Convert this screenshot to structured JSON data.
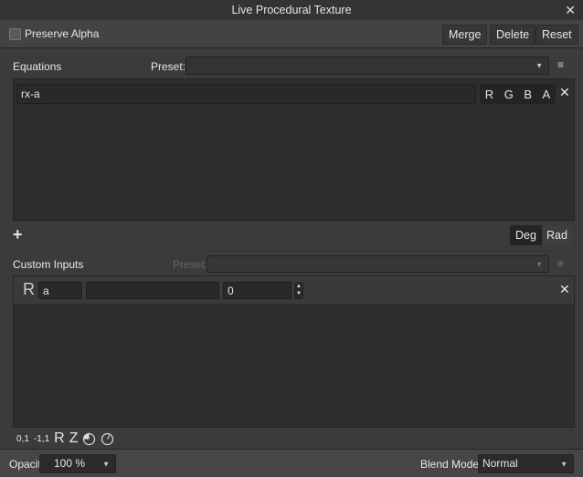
{
  "window": {
    "title": "Live Procedural Texture"
  },
  "toolbar": {
    "preserve_alpha": "Preserve Alpha",
    "preserve_alpha_checked": false,
    "merge": "Merge",
    "delete": "Delete",
    "reset": "Reset"
  },
  "equations": {
    "label": "Equations",
    "preset_label": "Preset:",
    "preset_value": "",
    "rows": [
      {
        "expression": "rx-a",
        "channels": [
          "R",
          "G",
          "B",
          "A"
        ]
      }
    ],
    "add": "+",
    "deg": "Deg",
    "rad": "Rad"
  },
  "custom_inputs": {
    "label": "Custom Inputs",
    "preset_label": "Preset:",
    "rows": [
      {
        "type": "R",
        "name": "a",
        "desc": "",
        "value": "0"
      }
    ]
  },
  "tools": {
    "t1": "0,1",
    "t2": "-1,1",
    "t3": "R",
    "t4": "Z"
  },
  "footer": {
    "opacity_label": "Opacity:",
    "opacity_value": "100 %",
    "blend_label": "Blend Mode:",
    "blend_value": "Normal"
  }
}
